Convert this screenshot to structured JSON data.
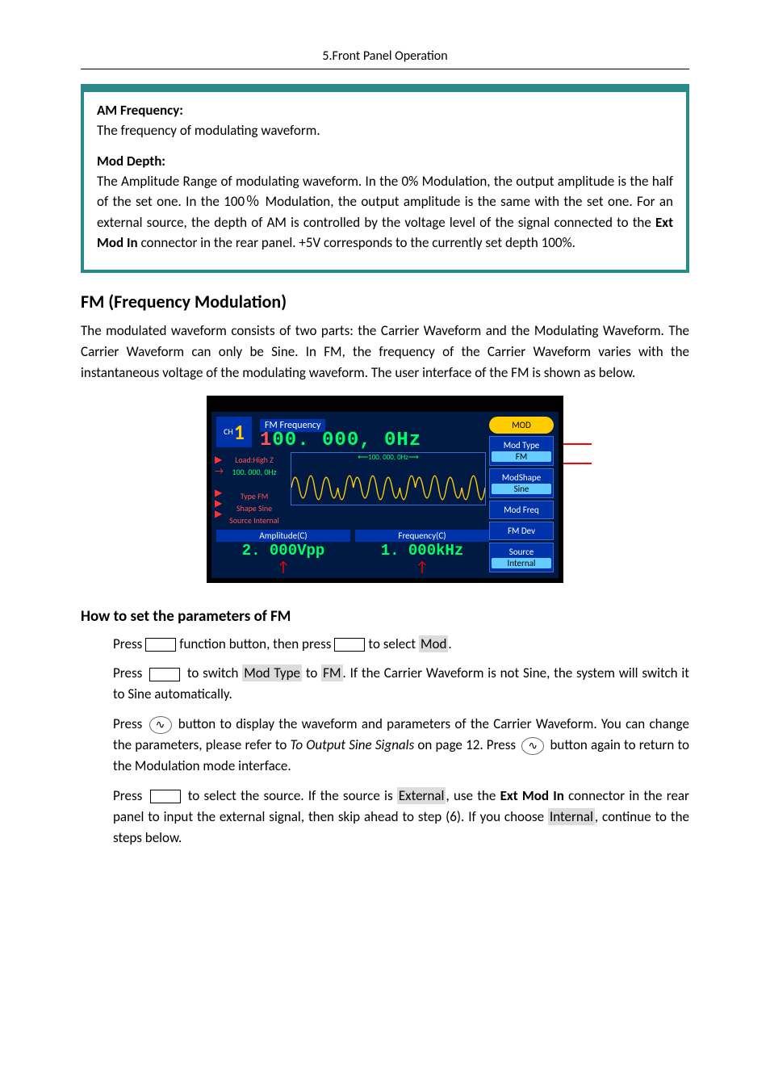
{
  "header": "5.Front Panel Operation",
  "box": {
    "t1_title": "AM Frequency:",
    "t1_body": "The frequency of modulating waveform.",
    "t2_title": "Mod Depth:",
    "t2_body_a": "The Amplitude Range of modulating waveform. In the 0% Modulation, the output amplitude is the half of the set one. In the 100％ Modulation, the output amplitude is the same with the set one. For an external source, the depth of AM is controlled by the voltage level of the signal connected to the ",
    "t2_body_b": "Ext Mod In",
    "t2_body_c": " connector in the rear panel. +5V corresponds to the currently set depth 100%."
  },
  "fm_heading": "FM (Frequency Modulation)",
  "fm_intro": "The modulated waveform consists of two parts: the Carrier Waveform and the Modulating Waveform. The Carrier Waveform can only be Sine. In FM, the frequency of the Carrier Waveform varies with the instantaneous voltage of the modulating waveform. The user interface of the FM is shown as below.",
  "lcd": {
    "ch_small": "CH",
    "ch_num": "1",
    "freq_label": "FM Frequency",
    "freq_lead": "1",
    "freq_rest": "00. 000, 0Hz",
    "load": "Load:High Z",
    "scale": "100. 000, 0Hz",
    "ref": "100. 000, 0Hz",
    "type": "Type  FM",
    "shape": "Shape  Sine",
    "source": "Source Internal",
    "sk_mod": "MOD",
    "sk_type": "Mod Type",
    "sk_type_val": "FM",
    "sk_shape": "ModShape",
    "sk_shape_val": "Sine",
    "sk_freq": "Mod Freq",
    "sk_dev": "FM Dev",
    "sk_src": "Source",
    "sk_src_val": "Internal",
    "amp_label": "Amplitude(C)",
    "amp_val": "2. 000Vpp",
    "frq_label": "Frequency(C)",
    "frq_val": "1. 000kHz"
  },
  "howto_heading": "How to set the parameters of FM",
  "s1_a": "Press",
  "s1_b": "function button, then press",
  "s1_c": "to select ",
  "s1_mod": "Mod",
  "s1_dot": ".",
  "s2_a": "Press ",
  "s2_b": " to switch ",
  "s2_mt": "Mod Type",
  "s2_c": " to ",
  "s2_fm": "FM",
  "s2_d": ". If the Carrier Waveform is not Sine, the system will switch it to Sine automatically.",
  "s3_a": "Press ",
  "s3_b": " button to display the waveform and parameters of the Carrier Waveform. You can change the parameters, please refer to ",
  "s3_i": "To Output Sine Signals",
  "s3_c": " on page 12. Press ",
  "s3_d": " button again to return to the Modulation mode interface.",
  "s4_a": "Press ",
  "s4_b": " to select the source. If the source is ",
  "s4_ext": "External",
  "s4_c": ", use the ",
  "s4_emi": "Ext Mod In",
  "s4_d": " connector in the rear panel to input the external signal, then skip ahead to step (6). If you choose ",
  "s4_int": "Internal",
  "s4_e": ", continue to the steps below."
}
